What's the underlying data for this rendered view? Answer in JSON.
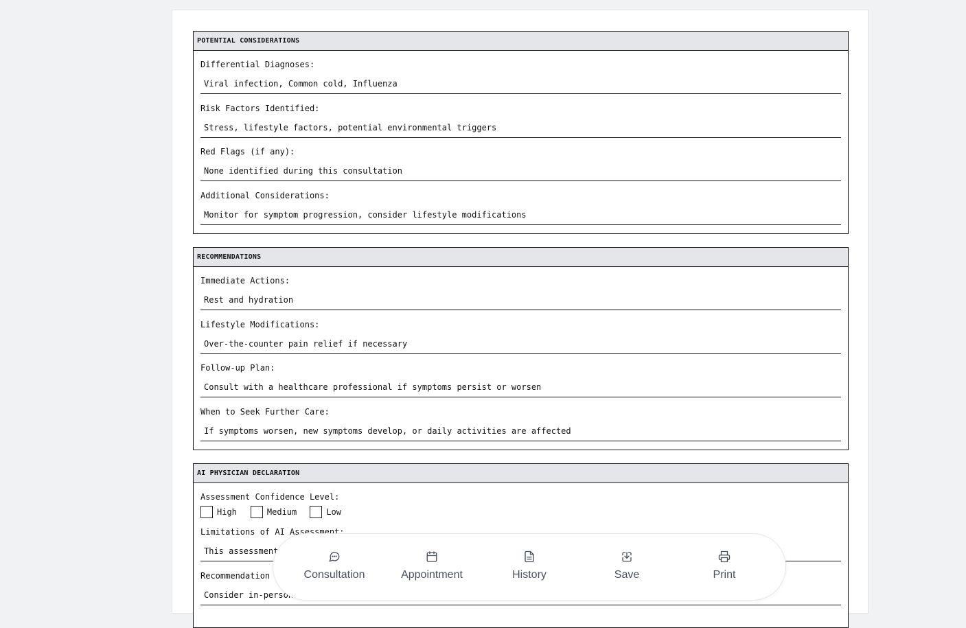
{
  "sections": {
    "potential": {
      "title": "POTENTIAL CONSIDERATIONS",
      "fields": [
        {
          "label": "Differential Diagnoses:",
          "value": "Viral infection, Common cold, Influenza"
        },
        {
          "label": "Risk Factors Identified:",
          "value": "Stress, lifestyle factors, potential environmental triggers"
        },
        {
          "label": "Red Flags (if any):",
          "value": "None identified during this consultation"
        },
        {
          "label": "Additional Considerations:",
          "value": "Monitor for symptom progression, consider lifestyle modifications"
        }
      ]
    },
    "recommendations": {
      "title": "RECOMMENDATIONS",
      "fields": [
        {
          "label": "Immediate Actions:",
          "value": "Rest and hydration"
        },
        {
          "label": "Lifestyle Modifications:",
          "value": "Over-the-counter pain relief if necessary"
        },
        {
          "label": "Follow-up Plan:",
          "value": "Consult with a healthcare professional if symptoms persist or worsen"
        },
        {
          "label": "When to Seek Further Care:",
          "value": "If symptoms worsen, new symptoms develop, or daily activities are affected"
        }
      ]
    },
    "declaration": {
      "title": "AI PHYSICIAN DECLARATION",
      "confidence_label": "Assessment Confidence Level:",
      "confidence_options": [
        "High",
        "Medium",
        "Low"
      ],
      "limitations_label": "Limitations of AI Assessment:",
      "limitations_value": "This assessment",
      "recommendation_label": "Recommendation f",
      "recommendation_value": "Consider in-person"
    }
  },
  "dock": {
    "items": [
      {
        "label": "Consultation",
        "icon": "message-circle-icon"
      },
      {
        "label": "Appointment",
        "icon": "calendar-icon"
      },
      {
        "label": "History",
        "icon": "file-text-icon"
      },
      {
        "label": "Save",
        "icon": "download-icon"
      },
      {
        "label": "Print",
        "icon": "printer-icon"
      }
    ]
  }
}
